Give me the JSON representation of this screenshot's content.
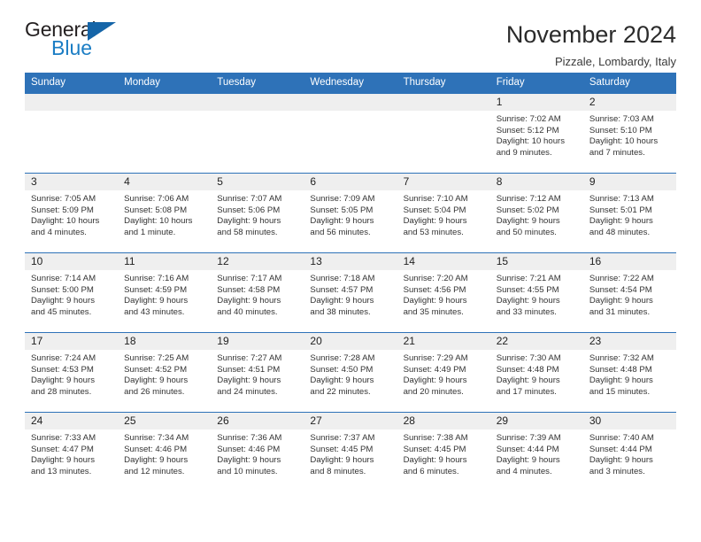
{
  "brand": {
    "name_top": "General",
    "name_bottom": "Blue",
    "triangle_color": "#1565a8",
    "blue_text_color": "#1b7dc4"
  },
  "header": {
    "title": "November 2024",
    "subtitle": "Pizzale, Lombardy, Italy"
  },
  "theme": {
    "header_blue": "#2e72b8",
    "daynum_band": "#efefef",
    "cell_background": "#ffffff"
  },
  "weekday_headers": [
    "Sunday",
    "Monday",
    "Tuesday",
    "Wednesday",
    "Thursday",
    "Friday",
    "Saturday"
  ],
  "labels": {
    "sunrise_prefix": "Sunrise: ",
    "sunset_prefix": "Sunset: ",
    "daylight_prefix": "Daylight: "
  },
  "weeks": [
    [
      {
        "day": "",
        "sunrise": "",
        "sunset": "",
        "daylight_line1": "",
        "daylight_line2": ""
      },
      {
        "day": "",
        "sunrise": "",
        "sunset": "",
        "daylight_line1": "",
        "daylight_line2": ""
      },
      {
        "day": "",
        "sunrise": "",
        "sunset": "",
        "daylight_line1": "",
        "daylight_line2": ""
      },
      {
        "day": "",
        "sunrise": "",
        "sunset": "",
        "daylight_line1": "",
        "daylight_line2": ""
      },
      {
        "day": "",
        "sunrise": "",
        "sunset": "",
        "daylight_line1": "",
        "daylight_line2": ""
      },
      {
        "day": "1",
        "sunrise": "Sunrise: 7:02 AM",
        "sunset": "Sunset: 5:12 PM",
        "daylight_line1": "Daylight: 10 hours",
        "daylight_line2": "and 9 minutes."
      },
      {
        "day": "2",
        "sunrise": "Sunrise: 7:03 AM",
        "sunset": "Sunset: 5:10 PM",
        "daylight_line1": "Daylight: 10 hours",
        "daylight_line2": "and 7 minutes."
      }
    ],
    [
      {
        "day": "3",
        "sunrise": "Sunrise: 7:05 AM",
        "sunset": "Sunset: 5:09 PM",
        "daylight_line1": "Daylight: 10 hours",
        "daylight_line2": "and 4 minutes."
      },
      {
        "day": "4",
        "sunrise": "Sunrise: 7:06 AM",
        "sunset": "Sunset: 5:08 PM",
        "daylight_line1": "Daylight: 10 hours",
        "daylight_line2": "and 1 minute."
      },
      {
        "day": "5",
        "sunrise": "Sunrise: 7:07 AM",
        "sunset": "Sunset: 5:06 PM",
        "daylight_line1": "Daylight: 9 hours",
        "daylight_line2": "and 58 minutes."
      },
      {
        "day": "6",
        "sunrise": "Sunrise: 7:09 AM",
        "sunset": "Sunset: 5:05 PM",
        "daylight_line1": "Daylight: 9 hours",
        "daylight_line2": "and 56 minutes."
      },
      {
        "day": "7",
        "sunrise": "Sunrise: 7:10 AM",
        "sunset": "Sunset: 5:04 PM",
        "daylight_line1": "Daylight: 9 hours",
        "daylight_line2": "and 53 minutes."
      },
      {
        "day": "8",
        "sunrise": "Sunrise: 7:12 AM",
        "sunset": "Sunset: 5:02 PM",
        "daylight_line1": "Daylight: 9 hours",
        "daylight_line2": "and 50 minutes."
      },
      {
        "day": "9",
        "sunrise": "Sunrise: 7:13 AM",
        "sunset": "Sunset: 5:01 PM",
        "daylight_line1": "Daylight: 9 hours",
        "daylight_line2": "and 48 minutes."
      }
    ],
    [
      {
        "day": "10",
        "sunrise": "Sunrise: 7:14 AM",
        "sunset": "Sunset: 5:00 PM",
        "daylight_line1": "Daylight: 9 hours",
        "daylight_line2": "and 45 minutes."
      },
      {
        "day": "11",
        "sunrise": "Sunrise: 7:16 AM",
        "sunset": "Sunset: 4:59 PM",
        "daylight_line1": "Daylight: 9 hours",
        "daylight_line2": "and 43 minutes."
      },
      {
        "day": "12",
        "sunrise": "Sunrise: 7:17 AM",
        "sunset": "Sunset: 4:58 PM",
        "daylight_line1": "Daylight: 9 hours",
        "daylight_line2": "and 40 minutes."
      },
      {
        "day": "13",
        "sunrise": "Sunrise: 7:18 AM",
        "sunset": "Sunset: 4:57 PM",
        "daylight_line1": "Daylight: 9 hours",
        "daylight_line2": "and 38 minutes."
      },
      {
        "day": "14",
        "sunrise": "Sunrise: 7:20 AM",
        "sunset": "Sunset: 4:56 PM",
        "daylight_line1": "Daylight: 9 hours",
        "daylight_line2": "and 35 minutes."
      },
      {
        "day": "15",
        "sunrise": "Sunrise: 7:21 AM",
        "sunset": "Sunset: 4:55 PM",
        "daylight_line1": "Daylight: 9 hours",
        "daylight_line2": "and 33 minutes."
      },
      {
        "day": "16",
        "sunrise": "Sunrise: 7:22 AM",
        "sunset": "Sunset: 4:54 PM",
        "daylight_line1": "Daylight: 9 hours",
        "daylight_line2": "and 31 minutes."
      }
    ],
    [
      {
        "day": "17",
        "sunrise": "Sunrise: 7:24 AM",
        "sunset": "Sunset: 4:53 PM",
        "daylight_line1": "Daylight: 9 hours",
        "daylight_line2": "and 28 minutes."
      },
      {
        "day": "18",
        "sunrise": "Sunrise: 7:25 AM",
        "sunset": "Sunset: 4:52 PM",
        "daylight_line1": "Daylight: 9 hours",
        "daylight_line2": "and 26 minutes."
      },
      {
        "day": "19",
        "sunrise": "Sunrise: 7:27 AM",
        "sunset": "Sunset: 4:51 PM",
        "daylight_line1": "Daylight: 9 hours",
        "daylight_line2": "and 24 minutes."
      },
      {
        "day": "20",
        "sunrise": "Sunrise: 7:28 AM",
        "sunset": "Sunset: 4:50 PM",
        "daylight_line1": "Daylight: 9 hours",
        "daylight_line2": "and 22 minutes."
      },
      {
        "day": "21",
        "sunrise": "Sunrise: 7:29 AM",
        "sunset": "Sunset: 4:49 PM",
        "daylight_line1": "Daylight: 9 hours",
        "daylight_line2": "and 20 minutes."
      },
      {
        "day": "22",
        "sunrise": "Sunrise: 7:30 AM",
        "sunset": "Sunset: 4:48 PM",
        "daylight_line1": "Daylight: 9 hours",
        "daylight_line2": "and 17 minutes."
      },
      {
        "day": "23",
        "sunrise": "Sunrise: 7:32 AM",
        "sunset": "Sunset: 4:48 PM",
        "daylight_line1": "Daylight: 9 hours",
        "daylight_line2": "and 15 minutes."
      }
    ],
    [
      {
        "day": "24",
        "sunrise": "Sunrise: 7:33 AM",
        "sunset": "Sunset: 4:47 PM",
        "daylight_line1": "Daylight: 9 hours",
        "daylight_line2": "and 13 minutes."
      },
      {
        "day": "25",
        "sunrise": "Sunrise: 7:34 AM",
        "sunset": "Sunset: 4:46 PM",
        "daylight_line1": "Daylight: 9 hours",
        "daylight_line2": "and 12 minutes."
      },
      {
        "day": "26",
        "sunrise": "Sunrise: 7:36 AM",
        "sunset": "Sunset: 4:46 PM",
        "daylight_line1": "Daylight: 9 hours",
        "daylight_line2": "and 10 minutes."
      },
      {
        "day": "27",
        "sunrise": "Sunrise: 7:37 AM",
        "sunset": "Sunset: 4:45 PM",
        "daylight_line1": "Daylight: 9 hours",
        "daylight_line2": "and 8 minutes."
      },
      {
        "day": "28",
        "sunrise": "Sunrise: 7:38 AM",
        "sunset": "Sunset: 4:45 PM",
        "daylight_line1": "Daylight: 9 hours",
        "daylight_line2": "and 6 minutes."
      },
      {
        "day": "29",
        "sunrise": "Sunrise: 7:39 AM",
        "sunset": "Sunset: 4:44 PM",
        "daylight_line1": "Daylight: 9 hours",
        "daylight_line2": "and 4 minutes."
      },
      {
        "day": "30",
        "sunrise": "Sunrise: 7:40 AM",
        "sunset": "Sunset: 4:44 PM",
        "daylight_line1": "Daylight: 9 hours",
        "daylight_line2": "and 3 minutes."
      }
    ]
  ]
}
